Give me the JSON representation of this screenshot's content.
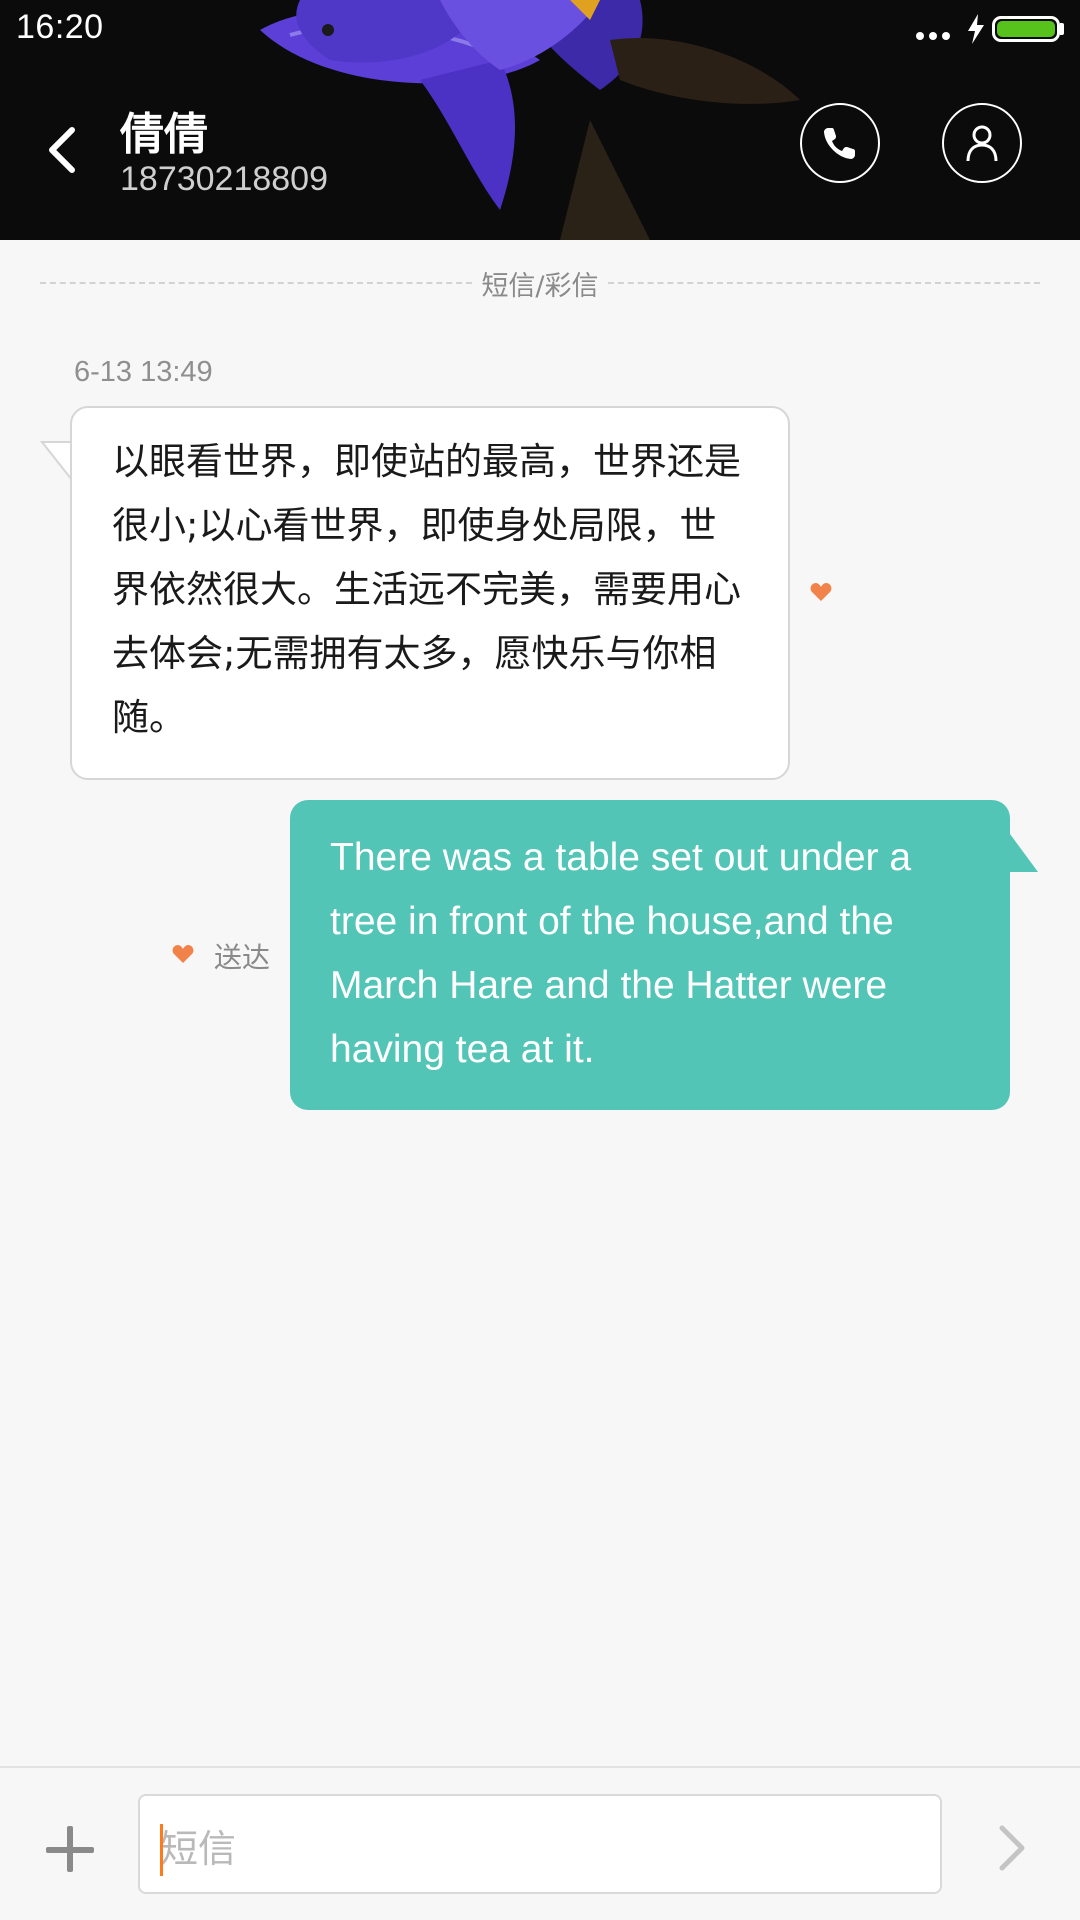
{
  "status_bar": {
    "time": "16:20",
    "battery_level": 1.0
  },
  "header": {
    "contact_name": "倩倩",
    "contact_number": "18730218809"
  },
  "conversation": {
    "channel_label": "短信/彩信",
    "messages": [
      {
        "direction": "incoming",
        "timestamp": "6-13 13:49",
        "text": "以眼看世界，即使站的最高，世界还是很小;以心看世界，即使身处局限，世界依然很大。生活远不完美，需要用心去体会;无需拥有太多，愿快乐与你相随。",
        "favorited": true
      },
      {
        "direction": "outgoing",
        "text": "There was a table set out under a tree in front of the house,and the March Hare and the Hatter were having tea at it.",
        "status": "送达",
        "favorited": true
      }
    ]
  },
  "composer": {
    "placeholder": "短信"
  },
  "icons": {
    "back": "back-arrow-icon",
    "call": "phone-icon",
    "contact": "person-icon",
    "favorite": "heart-icon",
    "add": "plus-icon",
    "send": "send-chevron-icon"
  },
  "colors": {
    "outgoing_bubble": "#53c5b6",
    "incoming_bubble": "#ffffff",
    "heart": "#f0824a",
    "caret": "#ff7a1a",
    "battery": "#58c21c"
  }
}
